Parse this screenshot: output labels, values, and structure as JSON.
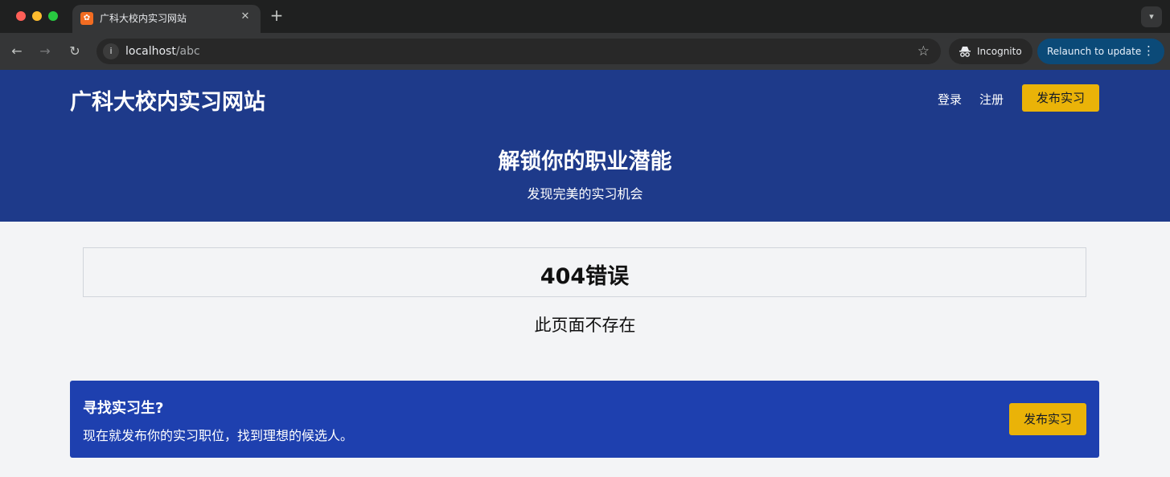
{
  "browser": {
    "tab_title": "广科大校内实习网站",
    "tab_close": "✕",
    "new_tab": "+",
    "url_host": "localhost",
    "url_path": "/abc",
    "incognito_label": "Incognito",
    "relaunch_label": "Relaunch to update",
    "icons": {
      "back": "arrow-left-icon",
      "forward": "arrow-right-icon",
      "reload": "reload-icon",
      "info": "info-icon",
      "bookmark": "star-icon",
      "incognito": "incognito-icon",
      "more": "more-vertical-icon"
    }
  },
  "header": {
    "brand": "广科大校内实习网站",
    "nav": {
      "login": "登录",
      "register": "注册",
      "post_button": "发布实习"
    },
    "hero_title": "解锁你的职业潜能",
    "hero_subtitle": "发现完美的实习机会"
  },
  "main": {
    "error_title": "404错误",
    "error_message": "此页面不存在"
  },
  "cta": {
    "title": "寻找实习生?",
    "text": "现在就发布你的实习职位，找到理想的候选人。",
    "button": "发布实习"
  },
  "colors": {
    "header_bg": "#1e3a8a",
    "cta_bg": "#1e40af",
    "button_yellow": "#eab308",
    "page_bg": "#f3f4f6"
  }
}
